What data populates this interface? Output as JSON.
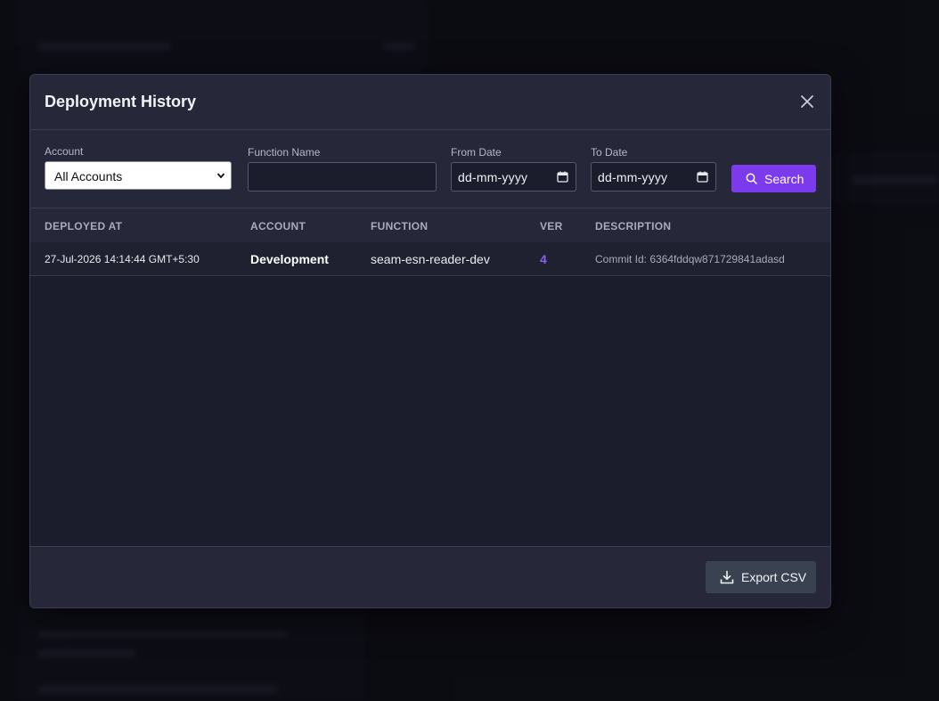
{
  "modal": {
    "title": "Deployment History"
  },
  "filters": {
    "account_label": "Account",
    "account_selected": "All Accounts",
    "function_label": "Function Name",
    "function_value": "",
    "from_label": "From Date",
    "from_value": "dd-mm-yyyy",
    "to_label": "To Date",
    "to_value": "dd-mm-yyyy",
    "search_label": "Search"
  },
  "table": {
    "columns": [
      "DEPLOYED AT",
      "ACCOUNT",
      "FUNCTION",
      "VER",
      "DESCRIPTION"
    ],
    "rows": [
      {
        "deployed_at": "27-Jul-2026 14:14:44 GMT+5:30",
        "account": "Development",
        "function": "seam-esn-reader-dev",
        "ver": "4",
        "description": "Commit Id: 6364fddqw871729841adasd"
      }
    ]
  },
  "footer": {
    "export_label": "Export CSV"
  },
  "colors": {
    "accent": "#7c3aed",
    "version": "#8b5cf6"
  },
  "icons": {
    "close": "close-icon",
    "calendar": "calendar-icon",
    "search": "search-icon",
    "download": "download-icon"
  }
}
